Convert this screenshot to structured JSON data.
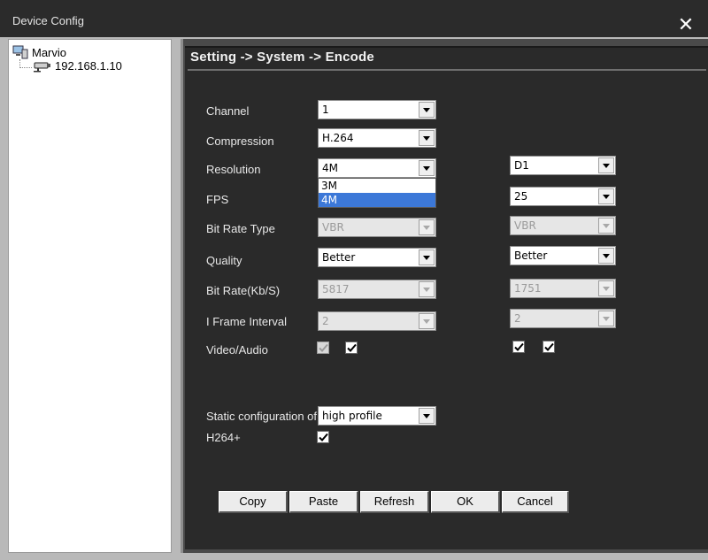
{
  "window": {
    "title": "Device Config",
    "close_label": "✕"
  },
  "tree": {
    "root": "Marvio",
    "child": "192.168.1.10"
  },
  "breadcrumb": "Setting -> System -> Encode",
  "fields": {
    "channel": {
      "label": "Channel",
      "value": "1"
    },
    "compression": {
      "label": "Compression",
      "value": "H.264"
    },
    "resolution": {
      "label": "Resolution",
      "main": "4M",
      "sub": "D1",
      "options": [
        "3M",
        "4M"
      ]
    },
    "fps": {
      "label": "FPS",
      "sub": "25"
    },
    "bitrate_type": {
      "label": "Bit Rate Type",
      "main": "VBR",
      "sub": "VBR"
    },
    "quality": {
      "label": "Quality",
      "main": "Better",
      "sub": "Better"
    },
    "bitrate": {
      "label": "Bit Rate(Kb/S)",
      "main": "5817",
      "sub": "1751"
    },
    "iframe": {
      "label": "I Frame Interval",
      "main": "2",
      "sub": "2"
    },
    "video_audio": {
      "label": "Video/Audio"
    },
    "static_config": {
      "label": "Static configuration of",
      "value": "high profile"
    },
    "h264plus": {
      "label": "H264+"
    }
  },
  "buttons": {
    "copy": "Copy",
    "paste": "Paste",
    "refresh": "Refresh",
    "ok": "OK",
    "cancel": "Cancel"
  }
}
